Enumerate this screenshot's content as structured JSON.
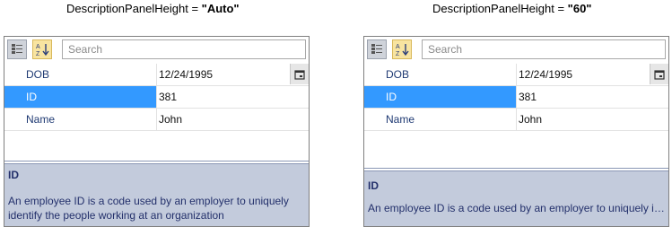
{
  "captions": {
    "left": {
      "prefix": "DescriptionPanelHeight = ",
      "value": "\"Auto\""
    },
    "right": {
      "prefix": "DescriptionPanelHeight = ",
      "value": "\"60\""
    }
  },
  "grids": [
    {
      "search_placeholder": "Search",
      "rows": [
        {
          "name": "DOB",
          "value": "12/24/1995"
        },
        {
          "name": "ID",
          "value": "381"
        },
        {
          "name": "Name",
          "value": "John"
        }
      ],
      "selected_row": "ID",
      "description": {
        "title": "ID",
        "text": "An employee ID is a code used by an employer to uniquely identify the people working at an organization"
      }
    },
    {
      "search_placeholder": "Search",
      "rows": [
        {
          "name": "DOB",
          "value": "12/24/1995"
        },
        {
          "name": "ID",
          "value": "381"
        },
        {
          "name": "Name",
          "value": "John"
        }
      ],
      "selected_row": "ID",
      "description": {
        "title": "ID",
        "text": "An employee ID is a code used by an employer to uniquely identify the people working at an organization"
      }
    }
  ],
  "icons": {
    "categorize": "categorize-icon",
    "sort_alpha": "sort-alphabetical-icon",
    "calendar": "calendar-icon"
  },
  "colors": {
    "selection": "#3399ff",
    "description_bg": "#c3cbdc",
    "property_name": "#1f3a73"
  }
}
